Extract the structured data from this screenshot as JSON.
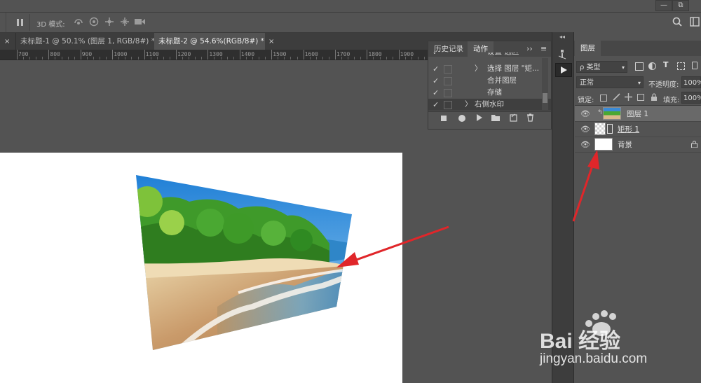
{
  "window_controls": [
    "—",
    "⧉"
  ],
  "options_bar": {
    "mode_label": "3D 模式:"
  },
  "tabs": [
    {
      "label": "未标题-1 @ 50.1% (图层 1, RGB/8#) *",
      "close": "×",
      "active": false
    },
    {
      "label": "未标题-2 @ 54.6%(RGB/8#) *",
      "close": "×",
      "active": true
    }
  ],
  "ruler_ticks": [
    "700",
    "800",
    "900",
    "1000",
    "1100",
    "1200",
    "1300",
    "1400",
    "1500",
    "1600",
    "1700",
    "1800",
    "1900",
    "2000"
  ],
  "actions_panel": {
    "tabs": [
      "历史记录",
      "动作"
    ],
    "rows": [
      {
        "check": "✓",
        "label": "设置 选区",
        "expand": ""
      },
      {
        "check": "✓",
        "label": "选择 图层 \"矩...",
        "expand": "〉"
      },
      {
        "check": "✓",
        "label": "合并图层",
        "expand": ""
      },
      {
        "check": "✓",
        "label": "存储",
        "expand": ""
      },
      {
        "check": "✓",
        "label": "右侧水印",
        "expand": "〉"
      }
    ]
  },
  "layers_panel": {
    "title": "图层",
    "filter": "ρ 类型",
    "blend_mode": "正常",
    "opacity_label": "不透明度:",
    "opacity_value": "100%",
    "lock_label": "锁定:",
    "fill_label": "填充:",
    "fill_value": "100%",
    "layers": [
      {
        "name": "图层 1",
        "selected": true
      },
      {
        "name": "矩形 1",
        "selected": false
      },
      {
        "name": "背景",
        "selected": false,
        "locked": true
      }
    ]
  },
  "watermark": {
    "brand": "Bai 经验",
    "url": "jingyan.baidu.com"
  },
  "colors": {
    "panel": "#535353",
    "dark": "#3d3d3d",
    "arrow": "#e0262a"
  }
}
